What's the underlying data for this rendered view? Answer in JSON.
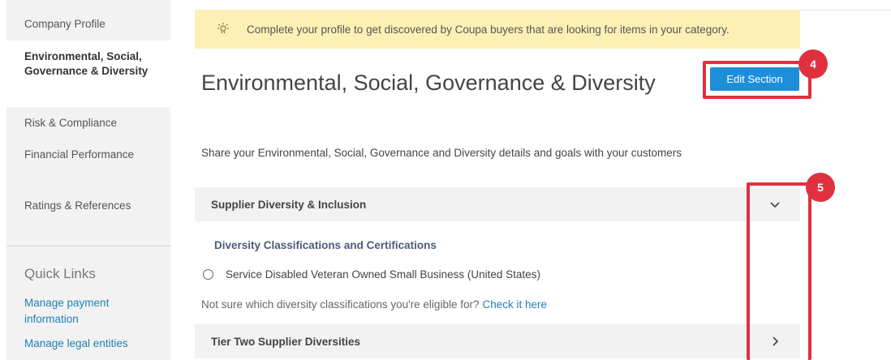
{
  "sidebar": {
    "items": [
      {
        "label": "Company Profile"
      },
      {
        "label": "Environmental, Social, Governance & Diversity"
      },
      {
        "label": "Risk & Compliance"
      },
      {
        "label": "Financial Performance"
      },
      {
        "label": "Ratings & References"
      }
    ],
    "quick_links_title": "Quick Links",
    "quick_links": [
      {
        "label": "Manage payment information"
      },
      {
        "label": "Manage legal entities"
      }
    ]
  },
  "banner": {
    "icon": "lightbulb-icon",
    "text": "Complete your profile to get discovered by Coupa buyers that are looking for items in your category."
  },
  "main": {
    "title": "Environmental, Social, Governance & Diversity",
    "edit_label": "Edit Section",
    "description": "Share your Environmental, Social, Governance and Diversity details and goals with your customers",
    "sections": [
      {
        "title": "Supplier Diversity & Inclusion",
        "state": "expanded",
        "icon": "chevron-down-icon"
      },
      {
        "title": "Tier Two Supplier Diversities",
        "state": "collapsed",
        "icon": "chevron-right-icon"
      }
    ],
    "subsection_title": "Diversity Classifications and Certifications",
    "option_label": "Service Disabled Veteran Owned Small Business (United States)",
    "hint_text": "Not sure which diversity classifications you're eligible for?",
    "hint_link": "Check it here"
  },
  "annotations": {
    "badge_4": "4",
    "badge_5": "5",
    "color": "#e0303f"
  },
  "colors": {
    "accent": "#1c8fd8",
    "link": "#1f7fb7",
    "banner_bg": "#fcf0b5"
  }
}
